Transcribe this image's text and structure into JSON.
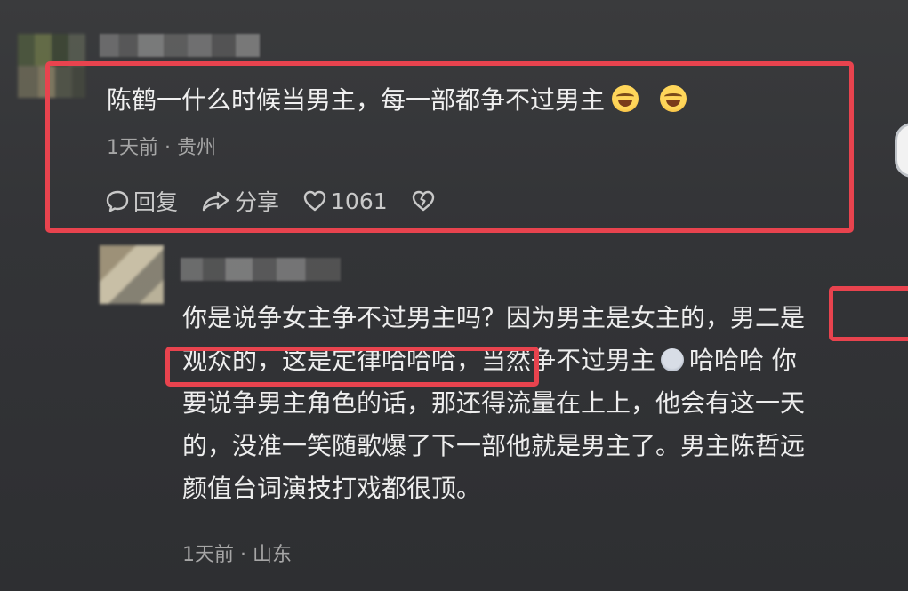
{
  "comment1": {
    "text": "陈鹤一什么时候当男主，每一部都争不过男主",
    "emojis": [
      "laughing-crying-emoji",
      "laughing-crying-emoji"
    ],
    "time": "1天前",
    "separator": "·",
    "location": "贵州",
    "reply_label": "回复",
    "share_label": "分享",
    "like_count": "1061"
  },
  "comment2": {
    "lines": [
      "你是说争女主争不过男主吗？因为男主是女主的，男二是",
      "观众的，这是定律哈哈哈，当然争不过男主",
      "要说争男主角色的话，那还得流量在上上，他会有这一天",
      "的，没准一笑随歌爆了下一部他就是男主了。男主陈哲远",
      "颜值台词演技打戏都很顶。"
    ],
    "line2_tail": "哈哈哈  你",
    "time": "1天前",
    "separator": "·",
    "location": "山东"
  },
  "colors": {
    "annotation_red": "#e8434e",
    "background": "#333437"
  }
}
